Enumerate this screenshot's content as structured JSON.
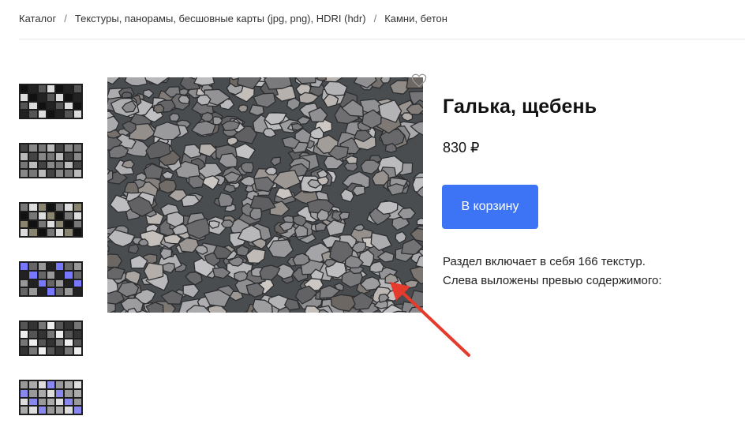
{
  "breadcrumb": {
    "items": [
      "Каталог",
      "Текстуры, панорамы, бесшовные карты (jpg, png), HDRI (hdr)",
      "Камни, бетон"
    ],
    "separator": "/"
  },
  "product": {
    "title": "Галька, щебень",
    "price": "830 ₽",
    "cart_button_label": "В корзину",
    "description_line1": "Раздел включает в себя 166 текстур.",
    "description_line2": "Слева выложены превью содержимого:"
  },
  "icons": {
    "favorite": "heart-outline-icon"
  },
  "colors": {
    "accent": "#3d73f5",
    "annotation_arrow": "#e53a2c"
  },
  "thumbnails": [
    {
      "name": "thumbnail-1",
      "palette": [
        "#111",
        "#ddd",
        "#eee",
        "#555",
        "#999",
        "#222",
        "#ccc"
      ]
    },
    {
      "name": "thumbnail-2",
      "palette": [
        "#222",
        "#888",
        "#eee",
        "#444",
        "#bbb",
        "#111",
        "#777"
      ]
    },
    {
      "name": "thumbnail-3",
      "palette": [
        "#111",
        "#aaa",
        "#8a8570",
        "#666",
        "#ddd",
        "#333",
        "#777"
      ]
    },
    {
      "name": "thumbnail-4",
      "palette": [
        "#666",
        "#ccc",
        "#7777ff",
        "#222",
        "#eee",
        "#999",
        "#444"
      ]
    },
    {
      "name": "thumbnail-5",
      "palette": [
        "#111",
        "#777",
        "#9999cc",
        "#333",
        "#ccc",
        "#555",
        "#eee"
      ]
    },
    {
      "name": "thumbnail-6",
      "palette": [
        "#222",
        "#999",
        "#8888ee",
        "#444",
        "#ddd",
        "#111",
        "#aaa"
      ]
    }
  ]
}
